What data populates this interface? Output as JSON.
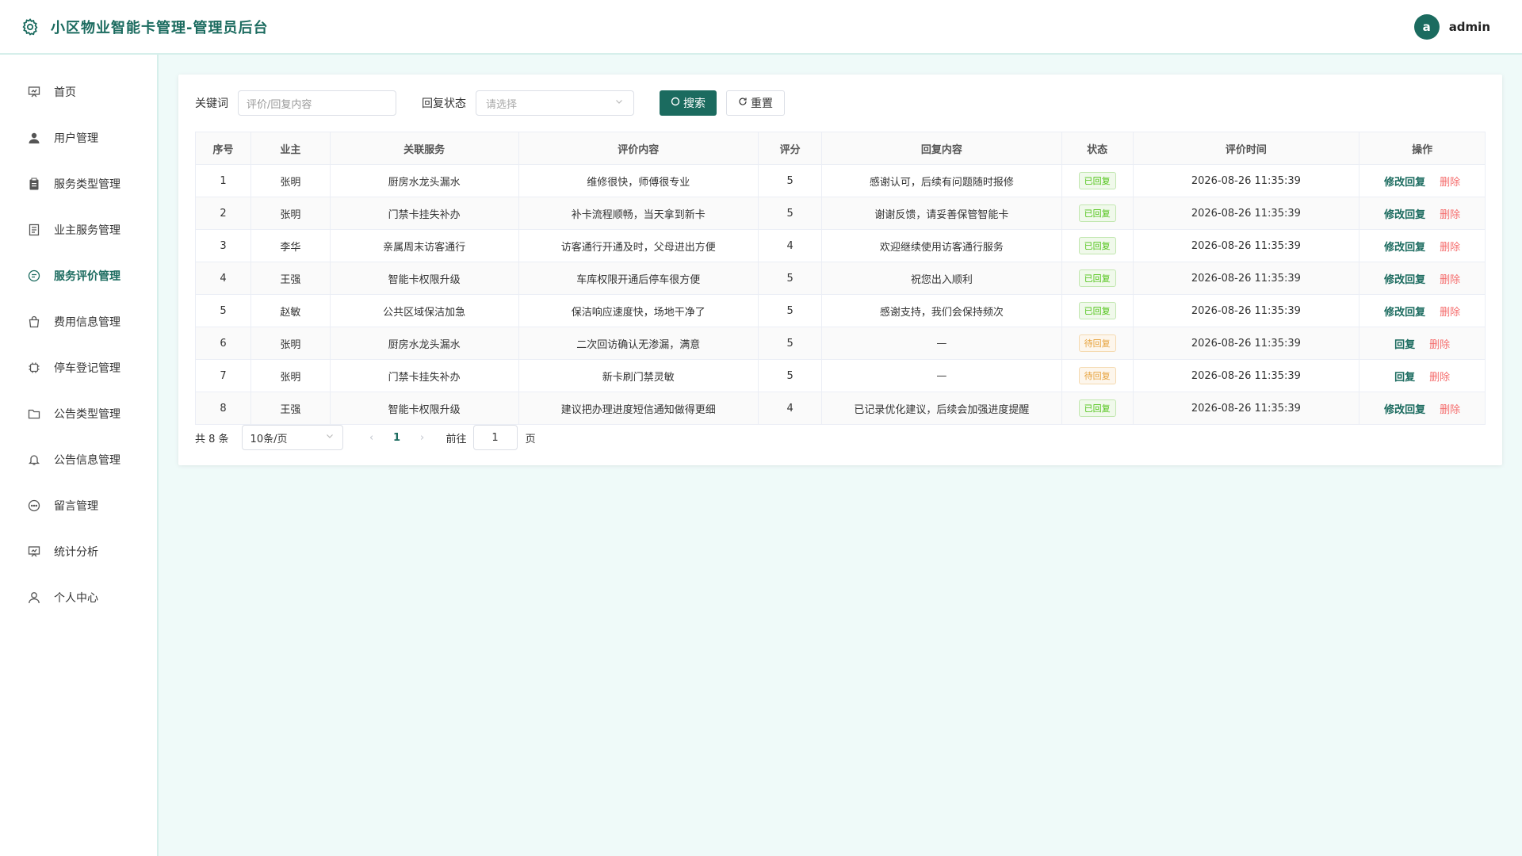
{
  "header": {
    "title": "小区物业智能卡管理-管理员后台",
    "avatar_letter": "a",
    "username": "admin"
  },
  "colors": {
    "primary": "#1b6b5f",
    "danger": "#f56c6c",
    "success": "#52c41a",
    "warning": "#e6a23c"
  },
  "sidebar": {
    "items": [
      {
        "label": "首页",
        "icon": "presentation-icon"
      },
      {
        "label": "用户管理",
        "icon": "user-icon"
      },
      {
        "label": "服务类型管理",
        "icon": "clipboard-icon"
      },
      {
        "label": "业主服务管理",
        "icon": "document-icon"
      },
      {
        "label": "服务评价管理",
        "icon": "chat-bubble-icon",
        "active": true
      },
      {
        "label": "费用信息管理",
        "icon": "shopping-bag-icon"
      },
      {
        "label": "停车登记管理",
        "icon": "chip-icon"
      },
      {
        "label": "公告类型管理",
        "icon": "folder-icon"
      },
      {
        "label": "公告信息管理",
        "icon": "bell-icon"
      },
      {
        "label": "留言管理",
        "icon": "comment-icon"
      },
      {
        "label": "统计分析",
        "icon": "chart-board-icon"
      },
      {
        "label": "个人中心",
        "icon": "person-icon"
      }
    ]
  },
  "filters": {
    "keyword_label": "关键词",
    "keyword_placeholder": "评价/回复内容",
    "status_label": "回复状态",
    "status_placeholder": "请选择",
    "search_label": "搜索",
    "reset_label": "重置"
  },
  "table": {
    "columns": [
      "序号",
      "业主",
      "关联服务",
      "评价内容",
      "评分",
      "回复内容",
      "状态",
      "评价时间",
      "操作"
    ],
    "rows": [
      {
        "no": "1",
        "owner": "张明",
        "service": "厨房水龙头漏水",
        "comment": "维修很快，师傅很专业",
        "score": "5",
        "reply": "感谢认可，后续有问题随时报修",
        "status": "已回复",
        "time": "2026-08-26 11:35:39",
        "op": "修改回复",
        "del": "删除"
      },
      {
        "no": "2",
        "owner": "张明",
        "service": "门禁卡挂失补办",
        "comment": "补卡流程顺畅，当天拿到新卡",
        "score": "5",
        "reply": "谢谢反馈，请妥善保管智能卡",
        "status": "已回复",
        "time": "2026-08-26 11:35:39",
        "op": "修改回复",
        "del": "删除"
      },
      {
        "no": "3",
        "owner": "李华",
        "service": "亲属周末访客通行",
        "comment": "访客通行开通及时，父母进出方便",
        "score": "4",
        "reply": "欢迎继续使用访客通行服务",
        "status": "已回复",
        "time": "2026-08-26 11:35:39",
        "op": "修改回复",
        "del": "删除"
      },
      {
        "no": "4",
        "owner": "王强",
        "service": "智能卡权限升级",
        "comment": "车库权限开通后停车很方便",
        "score": "5",
        "reply": "祝您出入顺利",
        "status": "已回复",
        "time": "2026-08-26 11:35:39",
        "op": "修改回复",
        "del": "删除"
      },
      {
        "no": "5",
        "owner": "赵敏",
        "service": "公共区域保洁加急",
        "comment": "保洁响应速度快，场地干净了",
        "score": "5",
        "reply": "感谢支持，我们会保持频次",
        "status": "已回复",
        "time": "2026-08-26 11:35:39",
        "op": "修改回复",
        "del": "删除"
      },
      {
        "no": "6",
        "owner": "张明",
        "service": "厨房水龙头漏水",
        "comment": "二次回访确认无渗漏，满意",
        "score": "5",
        "reply": "—",
        "status": "待回复",
        "time": "2026-08-26 11:35:39",
        "op": "回复",
        "del": "删除"
      },
      {
        "no": "7",
        "owner": "张明",
        "service": "门禁卡挂失补办",
        "comment": "新卡刷门禁灵敏",
        "score": "5",
        "reply": "—",
        "status": "待回复",
        "time": "2026-08-26 11:35:39",
        "op": "回复",
        "del": "删除"
      },
      {
        "no": "8",
        "owner": "王强",
        "service": "智能卡权限升级",
        "comment": "建议把办理进度短信通知做得更细",
        "score": "4",
        "reply": "已记录优化建议，后续会加强进度提醒",
        "status": "已回复",
        "time": "2026-08-26 11:35:39",
        "op": "修改回复",
        "del": "删除"
      }
    ]
  },
  "pagination": {
    "total": "共 8 条",
    "page_size": "10条/页",
    "current": "1",
    "goto_label": "前往",
    "goto_value": "1",
    "page_suffix": "页"
  }
}
